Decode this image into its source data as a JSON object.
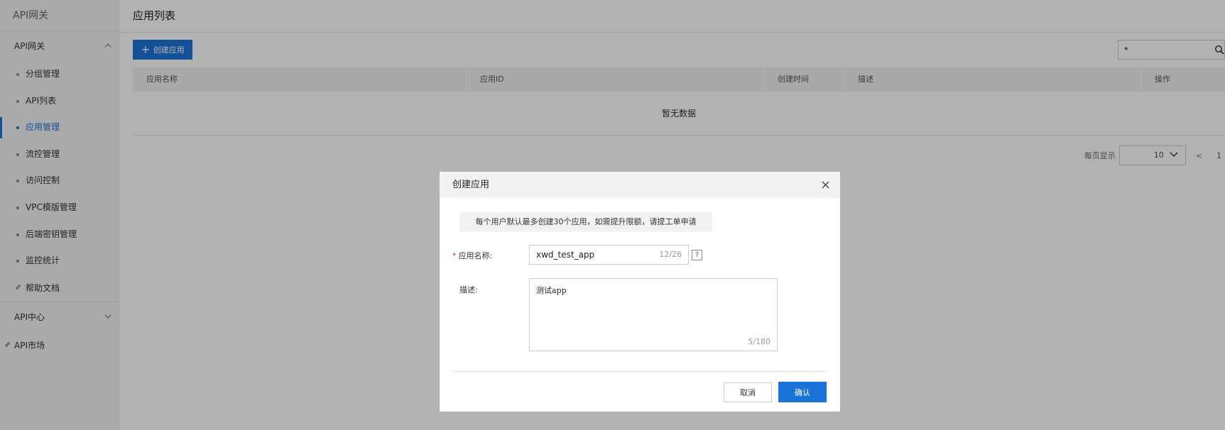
{
  "sidebar": {
    "brand": "API网关",
    "group_gateway": "API网关",
    "items": [
      {
        "label": "分组管理"
      },
      {
        "label": "API列表"
      },
      {
        "label": "应用管理"
      },
      {
        "label": "流控管理"
      },
      {
        "label": "访问控制"
      },
      {
        "label": "VPC模版管理"
      },
      {
        "label": "后端密钥管理"
      },
      {
        "label": "监控统计"
      }
    ],
    "help_docs": "帮助文档",
    "group_center": "API中心",
    "market": "API市场",
    "active_index": 2
  },
  "page": {
    "title": "应用列表",
    "create_button": "创建应用",
    "search_value": "*",
    "columns": [
      "应用名称",
      "应用ID",
      "创建时间",
      "描述",
      "操作"
    ],
    "empty_text": "暂无数据",
    "pager": {
      "per_page_label": "每页显示",
      "per_page_value": "10",
      "prev": "<",
      "current_page": "1"
    }
  },
  "dialog": {
    "title": "创建应用",
    "notice": "每个用户默认最多创建30个应用，如需提升限额，请提工单申请",
    "name_label": "应用名称:",
    "name_value": "xwd_test_app",
    "name_count": "12/26",
    "help": "?",
    "desc_label": "描述:",
    "desc_value": "测试app",
    "desc_count": "5/180",
    "cancel": "取消",
    "confirm": "确认"
  },
  "colors": {
    "primary": "#1a73d9",
    "required": "#e0301e",
    "overlay": "rgba(0,0,0,0.3)"
  }
}
